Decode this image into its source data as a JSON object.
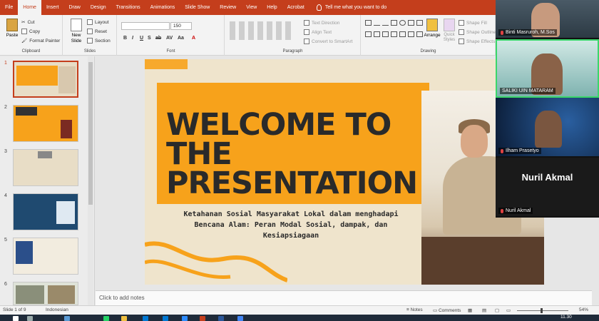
{
  "ribbon_tabs": [
    "File",
    "Home",
    "Insert",
    "Draw",
    "Design",
    "Transitions",
    "Animations",
    "Slide Show",
    "Review",
    "View",
    "Help",
    "Acrobat"
  ],
  "tell_me": "Tell me what you want to do",
  "clipboard": {
    "paste": "Paste",
    "cut": "Cut",
    "copy": "Copy",
    "format_painter": "Format Painter",
    "label": "Clipboard"
  },
  "slides_group": {
    "new_slide": "New Slide",
    "layout": "Layout",
    "reset": "Reset",
    "section": "Section",
    "label": "Slides"
  },
  "font_group": {
    "font_size": "150",
    "label": "Font",
    "buttons": [
      "B",
      "I",
      "U",
      "S",
      "ab",
      "AV",
      "Aa",
      "A"
    ]
  },
  "paragraph_group": {
    "text_direction": "Text Direction",
    "align_text": "Align Text",
    "convert_smartart": "Convert to SmartArt",
    "label": "Paragraph"
  },
  "drawing_group": {
    "arrange": "Arrange",
    "quick_styles": "Quick Styles",
    "shape_fill": "Shape Fill",
    "shape_outline": "Shape Outline",
    "shape_effects": "Shape Effects",
    "label": "Drawing"
  },
  "thumbnails": [
    "1",
    "2",
    "3",
    "4",
    "5",
    "6"
  ],
  "slide": {
    "title": "WELCOME TO THE PRESENTATION",
    "subtitle": "Ketahanan Sosial Masyarakat Lokal dalam menghadapi Bencana Alam: Peran Modal Sosial, dampak, dan Kesiapsiagaan"
  },
  "notes_placeholder": "Click to add notes",
  "status": {
    "slide_of": "Slide 1 of 9",
    "language": "Indonesian",
    "notes": "Notes",
    "comments": "Comments",
    "zoom": "54%"
  },
  "clock": "11.30",
  "participants": [
    {
      "name": "Binti Masruroh, M.Sos"
    },
    {
      "name": "SALIKI UIN MATARAM"
    },
    {
      "name": "Ilham Prasetyo"
    },
    {
      "name": "Nuril Akmal",
      "avatar_text": "Nuril Akmal"
    }
  ],
  "colors": {
    "accent": "#c43e1c",
    "slide_orange": "#f7a21b",
    "slide_bg": "#efe4cc"
  }
}
